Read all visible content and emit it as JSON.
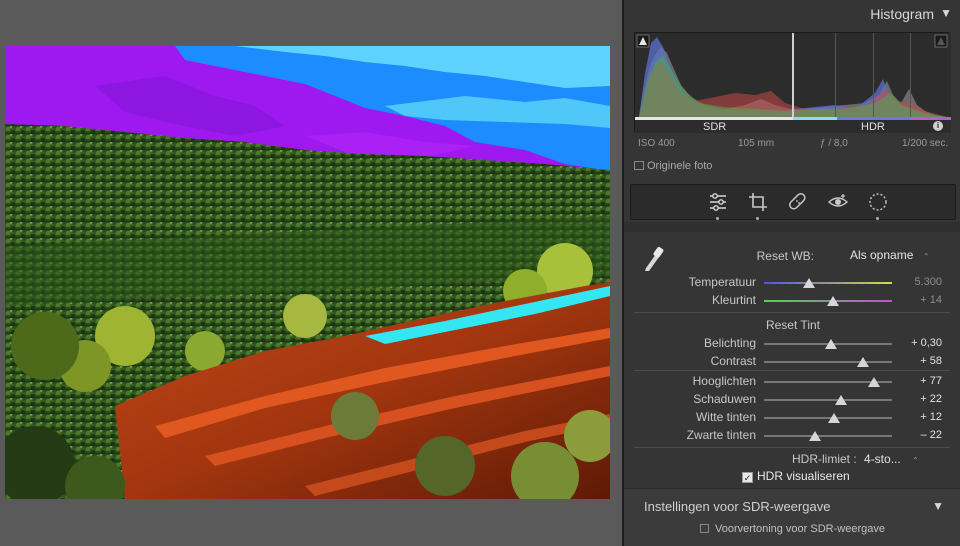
{
  "histogram": {
    "title": "Histogram",
    "sdr_label": "SDR",
    "hdr_label": "HDR",
    "info_label": "i",
    "iso": "ISO 400",
    "focal": "105 mm",
    "aperture": "ƒ / 8,0",
    "shutter": "1/200 sec.",
    "original_photo": "Originele foto"
  },
  "tools": [
    "sliders-icon",
    "crop-icon",
    "healing-icon",
    "redeye-icon",
    "mask-icon"
  ],
  "basic": {
    "reset_wb_label": "Reset WB:",
    "wb_value": "Als opname",
    "sliders_wb": [
      {
        "label": "Temperatuur",
        "value": "5.300",
        "pos": 0.35
      },
      {
        "label": "Kleurtint",
        "value": "+ 14",
        "pos": 0.54
      }
    ],
    "reset_tint": "Reset Tint",
    "sliders_tone": [
      {
        "label": "Belichting",
        "value": "+ 0,30",
        "pos": 0.52
      },
      {
        "label": "Contrast",
        "value": "+ 58",
        "pos": 0.77
      }
    ],
    "sliders_presence": [
      {
        "label": "Hooglichten",
        "value": "+ 77",
        "pos": 0.86
      },
      {
        "label": "Schaduwen",
        "value": "+ 22",
        "pos": 0.6
      },
      {
        "label": "Witte tinten",
        "value": "+ 12",
        "pos": 0.55
      },
      {
        "label": "Zwarte tinten",
        "value": "– 22",
        "pos": 0.4
      }
    ],
    "hdr_limit_label": "HDR-limiet :",
    "hdr_limit_value": "4-sto...",
    "hdr_visualize": "HDR visualiseren"
  },
  "sdr_section": {
    "title": "Instellingen voor SDR-weergave",
    "preview": "Voorvertoning voor SDR-weergave"
  }
}
